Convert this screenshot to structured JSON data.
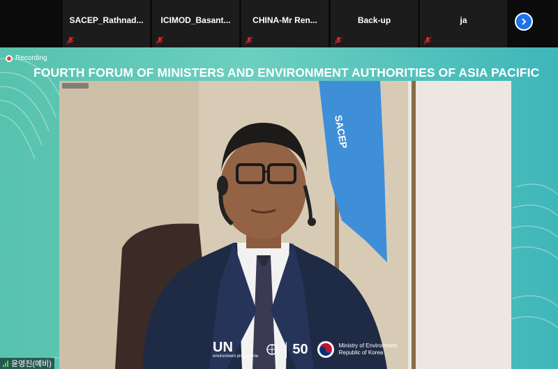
{
  "participants": [
    {
      "name": "SACEP_Rathnad...",
      "mic": "muted-mic-icon"
    },
    {
      "name": "ICIMOD_Basant...",
      "mic": "muted-mic-icon"
    },
    {
      "name": "CHINA-Mr  Ren...",
      "mic": "muted-mic-icon"
    },
    {
      "name": "Back-up",
      "mic": "muted-mic-icon"
    },
    {
      "name": "ja",
      "mic": "muted-mic-icon"
    }
  ],
  "next_page_icon": "chevron-right-icon",
  "recording_label": "Recording",
  "forum_title": "FOURTH FORUM OF MINISTERS AND ENVIRONMENT AUTHORITIES OF ASIA PACIFIC",
  "video": {
    "speaker_caption": "",
    "flag_text": "SACEP"
  },
  "sponsors": {
    "un_text": "UN",
    "un_sub": "environment programme",
    "anniversary": "50",
    "moe_line1": "Ministry of Environment",
    "moe_line2": "Republic of Korea"
  },
  "self_user": "윤영진(예비)",
  "colors": {
    "accent": "#1a73e8",
    "muted_mic": "#e02424",
    "stage_teal": "#57c2ae"
  }
}
